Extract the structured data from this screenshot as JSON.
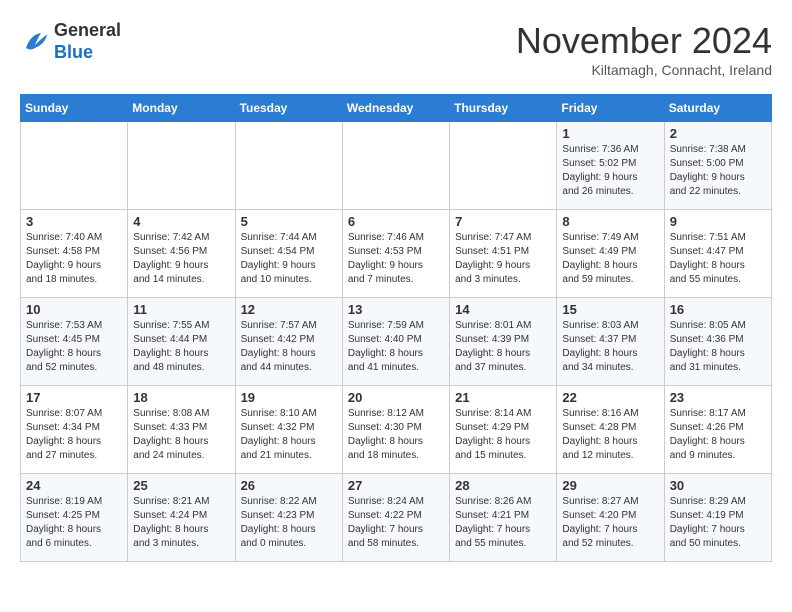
{
  "logo": {
    "general": "General",
    "blue": "Blue"
  },
  "title": "November 2024",
  "location": "Kiltamagh, Connacht, Ireland",
  "headers": [
    "Sunday",
    "Monday",
    "Tuesday",
    "Wednesday",
    "Thursday",
    "Friday",
    "Saturday"
  ],
  "weeks": [
    [
      {
        "day": "",
        "info": ""
      },
      {
        "day": "",
        "info": ""
      },
      {
        "day": "",
        "info": ""
      },
      {
        "day": "",
        "info": ""
      },
      {
        "day": "",
        "info": ""
      },
      {
        "day": "1",
        "info": "Sunrise: 7:36 AM\nSunset: 5:02 PM\nDaylight: 9 hours\nand 26 minutes."
      },
      {
        "day": "2",
        "info": "Sunrise: 7:38 AM\nSunset: 5:00 PM\nDaylight: 9 hours\nand 22 minutes."
      }
    ],
    [
      {
        "day": "3",
        "info": "Sunrise: 7:40 AM\nSunset: 4:58 PM\nDaylight: 9 hours\nand 18 minutes."
      },
      {
        "day": "4",
        "info": "Sunrise: 7:42 AM\nSunset: 4:56 PM\nDaylight: 9 hours\nand 14 minutes."
      },
      {
        "day": "5",
        "info": "Sunrise: 7:44 AM\nSunset: 4:54 PM\nDaylight: 9 hours\nand 10 minutes."
      },
      {
        "day": "6",
        "info": "Sunrise: 7:46 AM\nSunset: 4:53 PM\nDaylight: 9 hours\nand 7 minutes."
      },
      {
        "day": "7",
        "info": "Sunrise: 7:47 AM\nSunset: 4:51 PM\nDaylight: 9 hours\nand 3 minutes."
      },
      {
        "day": "8",
        "info": "Sunrise: 7:49 AM\nSunset: 4:49 PM\nDaylight: 8 hours\nand 59 minutes."
      },
      {
        "day": "9",
        "info": "Sunrise: 7:51 AM\nSunset: 4:47 PM\nDaylight: 8 hours\nand 55 minutes."
      }
    ],
    [
      {
        "day": "10",
        "info": "Sunrise: 7:53 AM\nSunset: 4:45 PM\nDaylight: 8 hours\nand 52 minutes."
      },
      {
        "day": "11",
        "info": "Sunrise: 7:55 AM\nSunset: 4:44 PM\nDaylight: 8 hours\nand 48 minutes."
      },
      {
        "day": "12",
        "info": "Sunrise: 7:57 AM\nSunset: 4:42 PM\nDaylight: 8 hours\nand 44 minutes."
      },
      {
        "day": "13",
        "info": "Sunrise: 7:59 AM\nSunset: 4:40 PM\nDaylight: 8 hours\nand 41 minutes."
      },
      {
        "day": "14",
        "info": "Sunrise: 8:01 AM\nSunset: 4:39 PM\nDaylight: 8 hours\nand 37 minutes."
      },
      {
        "day": "15",
        "info": "Sunrise: 8:03 AM\nSunset: 4:37 PM\nDaylight: 8 hours\nand 34 minutes."
      },
      {
        "day": "16",
        "info": "Sunrise: 8:05 AM\nSunset: 4:36 PM\nDaylight: 8 hours\nand 31 minutes."
      }
    ],
    [
      {
        "day": "17",
        "info": "Sunrise: 8:07 AM\nSunset: 4:34 PM\nDaylight: 8 hours\nand 27 minutes."
      },
      {
        "day": "18",
        "info": "Sunrise: 8:08 AM\nSunset: 4:33 PM\nDaylight: 8 hours\nand 24 minutes."
      },
      {
        "day": "19",
        "info": "Sunrise: 8:10 AM\nSunset: 4:32 PM\nDaylight: 8 hours\nand 21 minutes."
      },
      {
        "day": "20",
        "info": "Sunrise: 8:12 AM\nSunset: 4:30 PM\nDaylight: 8 hours\nand 18 minutes."
      },
      {
        "day": "21",
        "info": "Sunrise: 8:14 AM\nSunset: 4:29 PM\nDaylight: 8 hours\nand 15 minutes."
      },
      {
        "day": "22",
        "info": "Sunrise: 8:16 AM\nSunset: 4:28 PM\nDaylight: 8 hours\nand 12 minutes."
      },
      {
        "day": "23",
        "info": "Sunrise: 8:17 AM\nSunset: 4:26 PM\nDaylight: 8 hours\nand 9 minutes."
      }
    ],
    [
      {
        "day": "24",
        "info": "Sunrise: 8:19 AM\nSunset: 4:25 PM\nDaylight: 8 hours\nand 6 minutes."
      },
      {
        "day": "25",
        "info": "Sunrise: 8:21 AM\nSunset: 4:24 PM\nDaylight: 8 hours\nand 3 minutes."
      },
      {
        "day": "26",
        "info": "Sunrise: 8:22 AM\nSunset: 4:23 PM\nDaylight: 8 hours\nand 0 minutes."
      },
      {
        "day": "27",
        "info": "Sunrise: 8:24 AM\nSunset: 4:22 PM\nDaylight: 7 hours\nand 58 minutes."
      },
      {
        "day": "28",
        "info": "Sunrise: 8:26 AM\nSunset: 4:21 PM\nDaylight: 7 hours\nand 55 minutes."
      },
      {
        "day": "29",
        "info": "Sunrise: 8:27 AM\nSunset: 4:20 PM\nDaylight: 7 hours\nand 52 minutes."
      },
      {
        "day": "30",
        "info": "Sunrise: 8:29 AM\nSunset: 4:19 PM\nDaylight: 7 hours\nand 50 minutes."
      }
    ]
  ]
}
